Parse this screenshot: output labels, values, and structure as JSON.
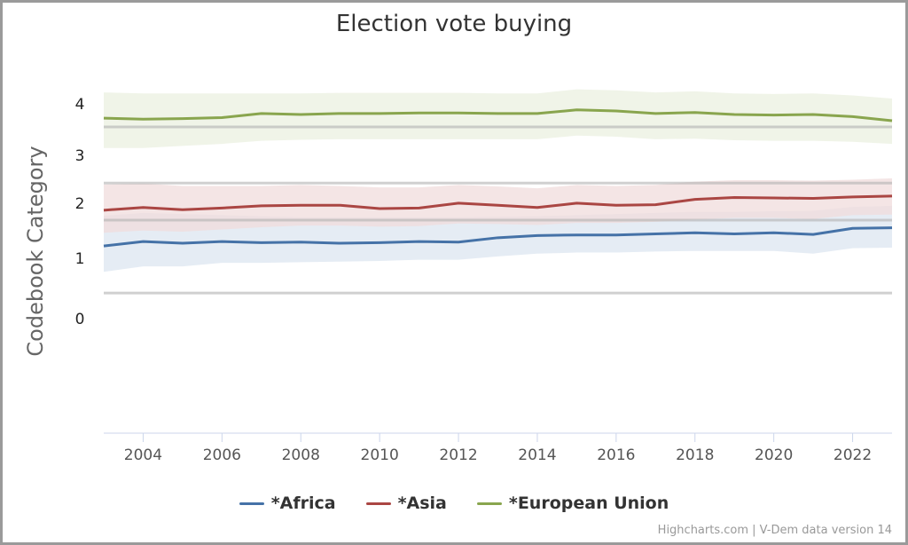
{
  "chart_data": {
    "type": "line",
    "title": "Election vote buying",
    "xlabel": "",
    "ylabel": "Codebook Category",
    "x": [
      2003,
      2004,
      2005,
      2006,
      2007,
      2008,
      2009,
      2010,
      2011,
      2012,
      2013,
      2014,
      2015,
      2016,
      2017,
      2018,
      2019,
      2020,
      2021,
      2022,
      2023
    ],
    "xticks": [
      "2004",
      "2006",
      "2008",
      "2010",
      "2012",
      "2014",
      "2016",
      "2018",
      "2020",
      "2022"
    ],
    "xtick_values": [
      2004,
      2006,
      2008,
      2010,
      2012,
      2014,
      2016,
      2018,
      2020,
      2022
    ],
    "yticks": [
      "0",
      "1",
      "2",
      "3",
      "4"
    ],
    "ytick_values": [
      0,
      1,
      2,
      3,
      4
    ],
    "xlim": [
      2003,
      2023
    ],
    "plot_lines": [
      3.57,
      2.44,
      1.71,
      0.44
    ],
    "grid": false,
    "legend_position": "bottom-center",
    "series": [
      {
        "name": "*Africa",
        "color": "#4572a7",
        "band_color": "#dce5f0",
        "values": [
          1.24,
          1.32,
          1.29,
          1.32,
          1.3,
          1.31,
          1.29,
          1.3,
          1.32,
          1.31,
          1.39,
          1.43,
          1.44,
          1.44,
          1.46,
          1.48,
          1.46,
          1.48,
          1.45,
          1.56,
          1.57
        ],
        "upper": [
          1.79,
          1.84,
          1.82,
          1.8,
          1.78,
          1.76,
          1.76,
          1.76,
          1.76,
          1.76,
          1.77,
          1.78,
          1.8,
          1.82,
          1.84,
          1.86,
          1.86,
          1.87,
          1.88,
          1.95,
          1.97
        ],
        "lower": [
          0.79,
          0.88,
          0.88,
          0.94,
          0.94,
          0.95,
          0.96,
          0.97,
          0.99,
          0.99,
          1.05,
          1.1,
          1.12,
          1.12,
          1.14,
          1.15,
          1.15,
          1.15,
          1.1,
          1.2,
          1.21
        ]
      },
      {
        "name": "*Asia",
        "color": "#aa4643",
        "band_color": "#f0dcdc",
        "values": [
          1.89,
          1.94,
          1.9,
          1.93,
          1.97,
          1.98,
          1.98,
          1.92,
          1.93,
          2.02,
          1.98,
          1.94,
          2.02,
          1.98,
          1.99,
          2.1,
          2.14,
          2.13,
          2.12,
          2.15,
          2.17
        ],
        "upper": [
          2.41,
          2.43,
          2.38,
          2.38,
          2.38,
          2.4,
          2.38,
          2.35,
          2.35,
          2.4,
          2.37,
          2.33,
          2.4,
          2.38,
          2.4,
          2.47,
          2.5,
          2.5,
          2.49,
          2.51,
          2.54
        ],
        "lower": [
          1.48,
          1.52,
          1.5,
          1.54,
          1.58,
          1.61,
          1.61,
          1.59,
          1.6,
          1.65,
          1.64,
          1.62,
          1.66,
          1.66,
          1.68,
          1.72,
          1.75,
          1.75,
          1.73,
          1.8,
          1.81
        ]
      },
      {
        "name": "*European Union",
        "color": "#89a54e",
        "band_color": "#ebf0e0",
        "values": [
          3.74,
          3.72,
          3.73,
          3.75,
          3.83,
          3.81,
          3.83,
          3.83,
          3.84,
          3.84,
          3.83,
          3.83,
          3.9,
          3.88,
          3.83,
          3.85,
          3.81,
          3.8,
          3.81,
          3.77,
          3.69
        ],
        "upper": [
          4.24,
          4.22,
          4.22,
          4.22,
          4.22,
          4.22,
          4.23,
          4.23,
          4.23,
          4.23,
          4.22,
          4.22,
          4.3,
          4.28,
          4.24,
          4.26,
          4.22,
          4.21,
          4.22,
          4.18,
          4.12
        ],
        "lower": [
          3.16,
          3.16,
          3.2,
          3.24,
          3.3,
          3.32,
          3.33,
          3.33,
          3.33,
          3.33,
          3.33,
          3.33,
          3.4,
          3.38,
          3.33,
          3.34,
          3.31,
          3.3,
          3.3,
          3.28,
          3.24
        ]
      }
    ]
  },
  "credits": "Highcharts.com | V-Dem data version 14"
}
